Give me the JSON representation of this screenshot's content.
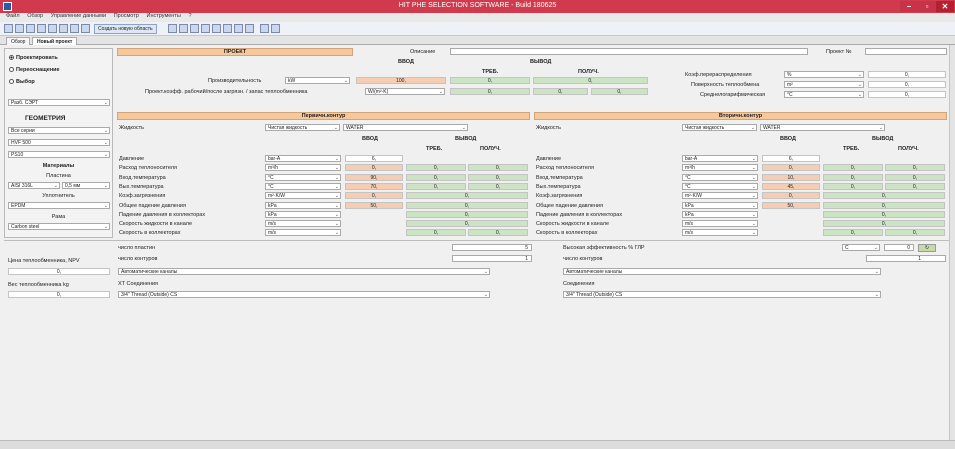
{
  "window": {
    "title": "HIT PHE SELECTION SOFTWARE - Build 180625",
    "btn_min": "–",
    "btn_max": "▫",
    "btn_close": "✕"
  },
  "menu": [
    "Файл",
    "Обзор",
    "Управление данными",
    "Просмотр",
    "Инструменты",
    "?"
  ],
  "toolbar": {
    "new_btn": "Создать новую область"
  },
  "tabs": [
    "Обзор",
    "Новый проект"
  ],
  "left": {
    "radio_project": "Проектировать",
    "radio_retrofit": "Переоснащение",
    "radio_select": "Выбор",
    "type_select": "Разб. СЭРТ",
    "geometry_title": "ГЕОМЕТРИЯ",
    "geom_select1": "Все серии",
    "geom_select2": "HVF 500",
    "geom_select3": "PS10",
    "materials_title": "Материалы",
    "plate_label": "Пластина",
    "plate_material": "AISI 316L",
    "plate_thickness": "0,5 мм",
    "gasket_label": "Уплотнитель",
    "gasket_material": "EPDM",
    "frame_label": "Рама",
    "frame_material": "Carbon steel"
  },
  "top": {
    "project_hdr": "ПРОЕКТ",
    "description_label": "Описание",
    "project_no_label": "Проект №",
    "input_hdr": "ВВОД",
    "output_hdr": "ВЫВОД",
    "required_hdr": "ТРЕБ.",
    "obtained_hdr": "ПОЛУЧ.",
    "capacity_label": "Производительность",
    "capacity_unit": "kW",
    "capacity_input": "100,",
    "capacity_out_req": "0,",
    "capacity_out_got": "0,",
    "htc_label": "Проект.коэфф. рабочий/после загрязн. / запас теплообменника",
    "htc_unit": "W/(m²·K)",
    "htc_in": "0,",
    "htc_out1": "0,",
    "htc_out2": "0,",
    "redund_label": "Коэф.перераспределения",
    "redund_unit": "%",
    "redund_val": "0,",
    "area_label": "Поверхность теплообмена",
    "area_unit": "m²",
    "area_val": "0,",
    "lmtd_label": "Среднелогарифмическая",
    "lmtd_unit": "°C",
    "lmtd_val": "0,"
  },
  "primary": {
    "title": "Первичн.контур",
    "fluid_label": "Жидкость",
    "fluid_type": "Чистая жидкость",
    "fluid_name": "WATER",
    "input_hdr": "ВВОД",
    "output_hdr": "ВЫВОД",
    "req_hdr": "ТРЕБ.",
    "got_hdr": "ПОЛУЧ.",
    "rows": [
      {
        "label": "Давление",
        "unit": "bar-A",
        "in": "6,",
        "req": "",
        "got": ""
      },
      {
        "label": "Расход теплоносителя",
        "unit": "m³/h",
        "in": "0,",
        "req": "0,",
        "got": "0,"
      },
      {
        "label": "Вход.температура",
        "unit": "°C",
        "in": "90,",
        "req": "0,",
        "got": "0,"
      },
      {
        "label": "Вых.температура",
        "unit": "°C",
        "in": "70,",
        "req": "0,",
        "got": "0,"
      },
      {
        "label": "Коэф.загрязнения",
        "unit": "m²·K/W",
        "in": "0,",
        "req": "0,",
        "got": ""
      },
      {
        "label": "Общее падение давления",
        "unit": "kPa",
        "in": "50,",
        "req": "0,",
        "got": ""
      },
      {
        "label": "Падение давления в коллекторах",
        "unit": "kPa",
        "in": "",
        "req": "0,",
        "got": ""
      },
      {
        "label": "Скорость жидкости в канале",
        "unit": "m/s",
        "in": "",
        "req": "0,",
        "got": ""
      },
      {
        "label": "Скорость в коллекторах",
        "unit": "m/s",
        "in": "",
        "req": "0,",
        "got": "0,"
      }
    ]
  },
  "secondary": {
    "title": "Вторичн.контур",
    "fluid_label": "Жидкость",
    "fluid_type": "Чистая жидкость",
    "fluid_name": "WATER",
    "input_hdr": "ВВОД",
    "output_hdr": "ВЫВОД",
    "req_hdr": "ТРЕБ.",
    "got_hdr": "ПОЛУЧ.",
    "rows": [
      {
        "label": "Давление",
        "unit": "bar-A",
        "in": "6,",
        "req": "",
        "got": ""
      },
      {
        "label": "Расход теплоносителя",
        "unit": "m³/h",
        "in": "0,",
        "req": "0,",
        "got": "0,"
      },
      {
        "label": "Вход.температура",
        "unit": "°C",
        "in": "10,",
        "req": "0,",
        "got": "0,"
      },
      {
        "label": "Вых.температура",
        "unit": "°C",
        "in": "45,",
        "req": "0,",
        "got": "0,"
      },
      {
        "label": "Коэф.загрязнения",
        "unit": "m²·K/W",
        "in": "0,",
        "req": "0,",
        "got": ""
      },
      {
        "label": "Общее падение давления",
        "unit": "kPa",
        "in": "50,",
        "req": "0,",
        "got": ""
      },
      {
        "label": "Падение давления в коллекторах",
        "unit": "kPa",
        "in": "",
        "req": "0,",
        "got": ""
      },
      {
        "label": "Скорость жидкости в канале",
        "unit": "m/s",
        "in": "",
        "req": "0,",
        "got": ""
      },
      {
        "label": "Скорость в коллекторах",
        "unit": "m/s",
        "in": "",
        "req": "0,",
        "got": "0,"
      }
    ]
  },
  "bottom": {
    "price_label": "Цена теплообменника, NPV",
    "price_val": "0,",
    "weight_label": "Вес теплообменника kg",
    "weight_val": "0,",
    "plates_label": "число пластин",
    "plates_val": "5",
    "passes_label": "число контуров",
    "passes_val": "1",
    "channels_select": "Автоматические каналы",
    "conn_label": "ХТ Соединения",
    "conn_select": "3/4\" Thread (Outside) CS",
    "eff_label": "Высокая эффективность % ГЛР",
    "eff_select": "С",
    "eff_val": "0",
    "passes2_label": "число контуров",
    "passes2_val": "1",
    "channels2_select": "Автоматические каналы",
    "conn2_label": "Соединения",
    "conn2_select": "3/4\" Thread (Outside) CS"
  }
}
